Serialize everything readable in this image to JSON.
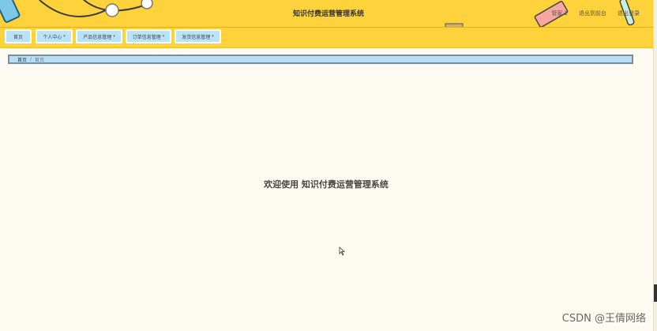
{
  "header": {
    "title": "知识付费运营管理系统",
    "user": "管家 1",
    "back_link": "退出到前台",
    "logout_link": "退出登录"
  },
  "nav": {
    "items": [
      {
        "label": "首页"
      },
      {
        "label": "个人中心"
      },
      {
        "label": "产品信息管理"
      },
      {
        "label": "订单信息管理"
      },
      {
        "label": "发货信息管理"
      }
    ]
  },
  "breadcrumb": {
    "home": "首页",
    "separator": "/",
    "current": "首页"
  },
  "main": {
    "welcome_text": "欢迎使用 知识付费运营管理系统"
  },
  "watermark": "CSDN @王倩网络",
  "colors": {
    "header_bg": "#fdd23a",
    "nav_item_bg": "#b9e3f8",
    "page_bg": "#fefcf2",
    "breadcrumb_bg": "#b6def8"
  }
}
